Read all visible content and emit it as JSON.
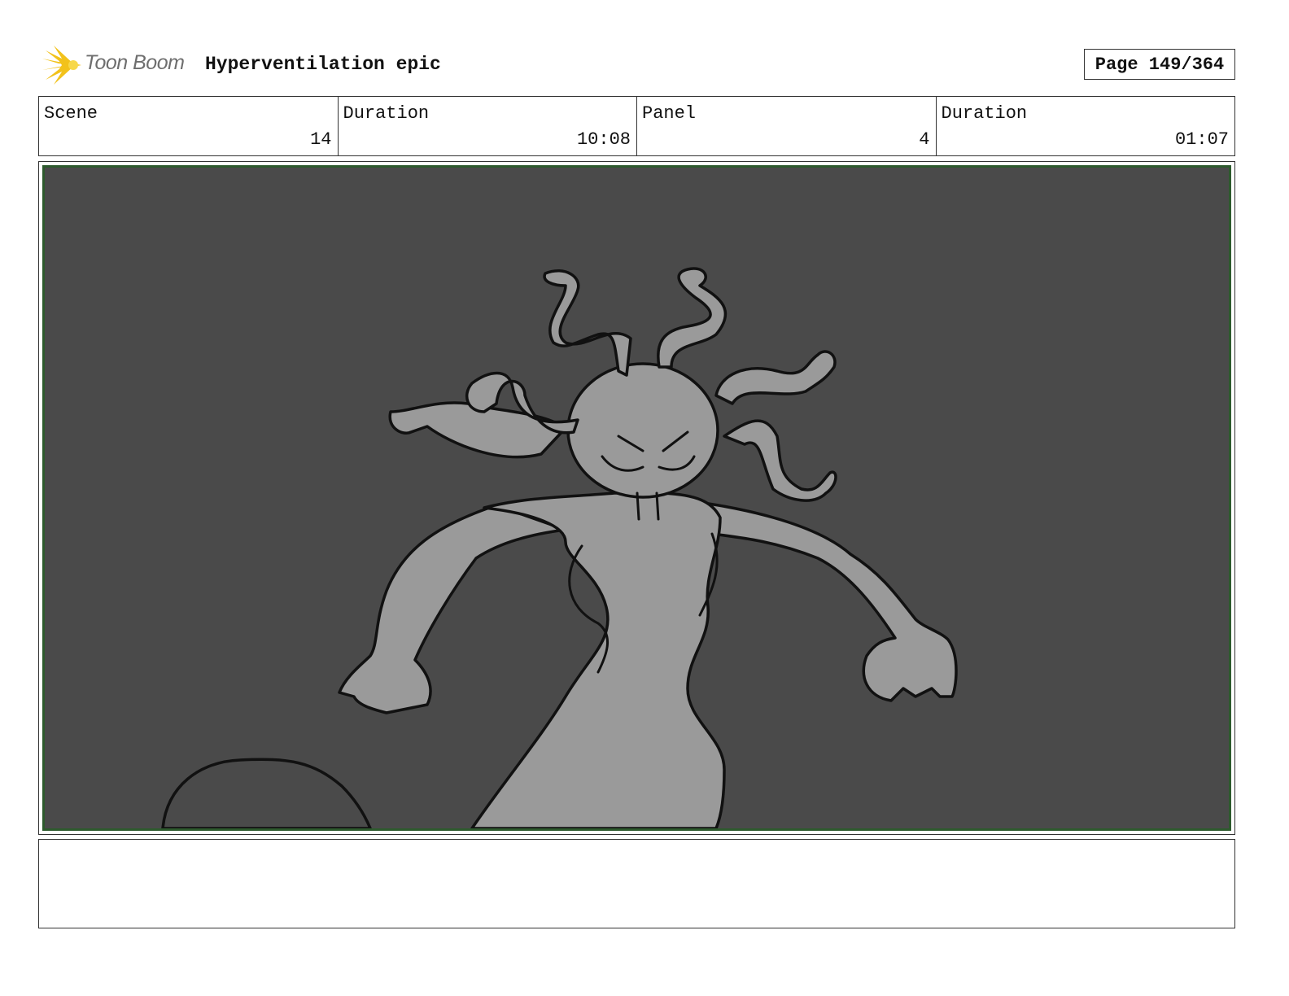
{
  "header": {
    "logo_text": "Toon Boom",
    "project_title": "Hyperventilation epic",
    "page_label": "Page 149/364"
  },
  "info": [
    {
      "label": "Scene",
      "value": "14"
    },
    {
      "label": "Duration",
      "value": "10:08"
    },
    {
      "label": "Panel",
      "value": "4"
    },
    {
      "label": "Duration",
      "value": "01:07"
    }
  ],
  "panel": {
    "background_color": "#4a4a4a",
    "frame_color": "#2d5a2d",
    "figure_color": "#9a9a9a"
  },
  "notes": {
    "text": ""
  }
}
